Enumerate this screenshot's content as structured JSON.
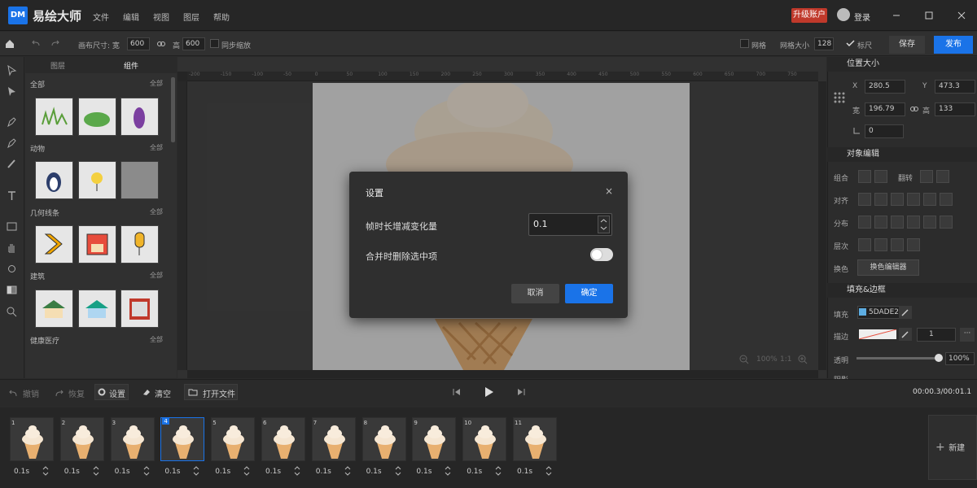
{
  "app": {
    "logo": "DM",
    "title": "易绘大师",
    "upgrade": "升级账户",
    "login": "登录"
  },
  "menu": [
    "文件",
    "编辑",
    "视图",
    "图层",
    "帮助"
  ],
  "toolbar": {
    "canvas_size_label": "画布尺寸: 宽",
    "width": "600",
    "height_label": "高",
    "height": "600",
    "sync_scale": "同步缩放",
    "grid": "网格",
    "grid_size_label": "网格大小",
    "grid_size": "128",
    "ruler": "标尺",
    "save": "保存",
    "publish": "发布"
  },
  "panel": {
    "tabs": [
      "图层",
      "组件"
    ],
    "categories": [
      {
        "name": "全部",
        "all": "全部"
      },
      {
        "name": "动物",
        "all": "全部"
      },
      {
        "name": "几何线条",
        "all": "全部"
      },
      {
        "name": "建筑",
        "all": "全部"
      },
      {
        "name": "健康医疗",
        "all": "全部"
      }
    ]
  },
  "ruler_ticks": [
    "-200",
    "-150",
    "-100",
    "-50",
    "0",
    "50",
    "100",
    "150",
    "200",
    "250",
    "300",
    "350",
    "400",
    "450",
    "500",
    "550",
    "600",
    "650",
    "700",
    "750"
  ],
  "zoom": {
    "percent": "100%",
    "ratio": "1:1"
  },
  "dialog": {
    "title": "设置",
    "close": "×",
    "label1": "帧时长增减变化量",
    "value1": "0.1",
    "label2": "合并时删除选中项",
    "toggle_on": false,
    "cancel": "取消",
    "ok": "确定"
  },
  "right": {
    "pos_section": "位置大小",
    "x_label": "X",
    "x": "280.5",
    "y_label": "Y",
    "y": "473.3",
    "w_label": "宽",
    "w": "196.79",
    "h_label": "高",
    "h": "133",
    "angle": "0",
    "obj_section": "对象编辑",
    "group": "组合",
    "flip": "翻转",
    "align": "对齐",
    "distribute": "分布",
    "layer": "层次",
    "swap_color": "换色",
    "color_editor": "换色编辑器",
    "fill_section": "填充&边框",
    "fill": "填充",
    "fill_color": "5DADE2",
    "stroke": "描边",
    "stroke_width": "1",
    "opacity": "透明",
    "opacity_value": "100%",
    "shadow": "阴影"
  },
  "bottom": {
    "undo": "撤销",
    "redo": "恢复",
    "settings": "设置",
    "clear": "清空",
    "open": "打开文件",
    "timecode": "00:00.3/00:01.1",
    "new_frame": "新建"
  },
  "frames": [
    {
      "num": "1",
      "dur": "0.1s"
    },
    {
      "num": "2",
      "dur": "0.1s"
    },
    {
      "num": "3",
      "dur": "0.1s"
    },
    {
      "num": "4",
      "dur": "0.1s"
    },
    {
      "num": "5",
      "dur": "0.1s"
    },
    {
      "num": "6",
      "dur": "0.1s"
    },
    {
      "num": "7",
      "dur": "0.1s"
    },
    {
      "num": "8",
      "dur": "0.1s"
    },
    {
      "num": "9",
      "dur": "0.1s"
    },
    {
      "num": "10",
      "dur": "0.1s"
    },
    {
      "num": "11",
      "dur": "0.1s"
    }
  ],
  "selected_frame": 4,
  "colors": {
    "accent": "#1a73e8",
    "upgrade": "#c0392b",
    "fill": "#5DADE2"
  }
}
